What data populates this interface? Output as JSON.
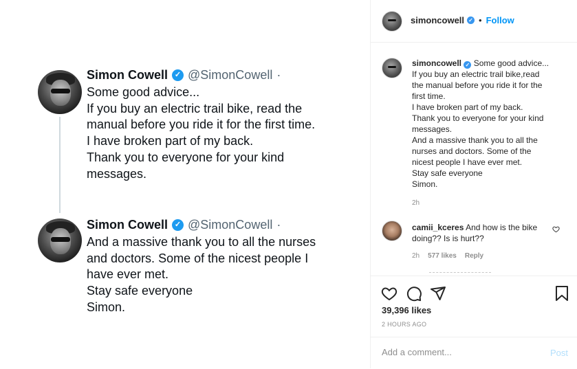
{
  "tweets": [
    {
      "name": "Simon Cowell",
      "handle": "@SimonCowell",
      "dot": "·",
      "lines": [
        "Some good advice...",
        "If you buy an electric trail bike, read the",
        "manual before you ride it for the first time.",
        "I have broken part of my back.",
        "Thank you to everyone for your kind",
        "messages."
      ]
    },
    {
      "name": "Simon Cowell",
      "handle": "@SimonCowell",
      "dot": "·",
      "lines": [
        "And a massive thank you to all the nurses",
        "and doctors. Some of the nicest people I",
        "have ever met.",
        "Stay safe everyone",
        "Simon."
      ]
    }
  ],
  "header": {
    "username": "simoncowell",
    "separator": "•",
    "follow_label": "Follow"
  },
  "caption": {
    "username": "simoncowell",
    "lines": [
      "Some good advice...",
      "If you buy an electric trail bike,read",
      "the manual before you ride it for the",
      "first time.",
      "I have broken part of my back.",
      "Thank you to everyone for your kind",
      "messages.",
      "And a massive thank you to all the",
      "nurses and doctors. Some of the",
      "nicest people I have ever met.",
      "Stay safe everyone",
      "Simon."
    ],
    "time": "2h"
  },
  "comment": {
    "username": "camii_kceres",
    "text_line1": "And how is the bike",
    "text_line2": "doing?? Is is hurt??",
    "time": "2h",
    "likes": "577 likes",
    "reply_label": "Reply"
  },
  "actions": {
    "icons": [
      "heart-icon",
      "comment-icon",
      "share-icon",
      "bookmark-icon"
    ]
  },
  "likes_text": "39,396 likes",
  "post_time": "2 HOURS AGO",
  "comment_box": {
    "placeholder": "Add a comment...",
    "post_label": "Post"
  },
  "colors": {
    "link_blue": "#0095f6",
    "verified_blue": "#1d9bf0",
    "muted": "#8e8e8e"
  }
}
